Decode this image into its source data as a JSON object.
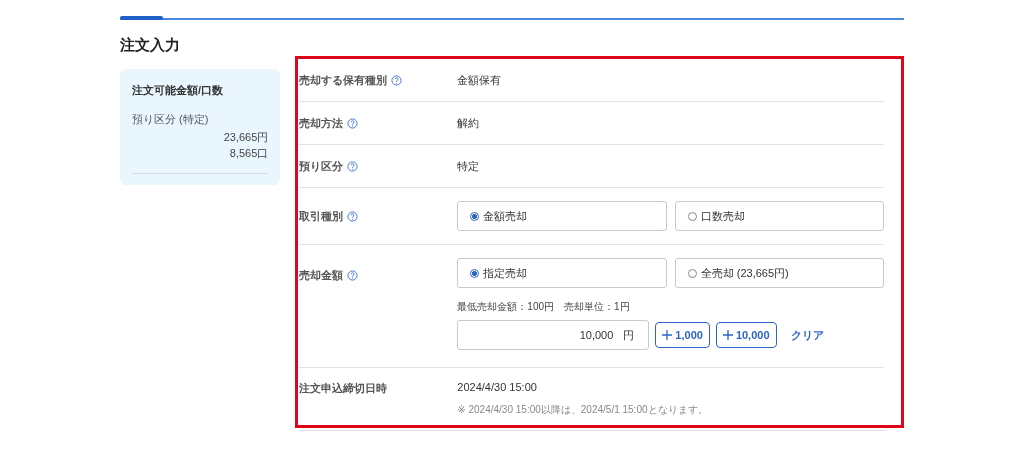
{
  "progress": {
    "level": 0.055
  },
  "title": "注文入力",
  "summary": {
    "heading": "注文可能金額/口数",
    "label": "預り区分 (特定)",
    "values": [
      "23,665円",
      "8,565口"
    ]
  },
  "rows": [
    {
      "kind": "text",
      "label": "売却する保有種別",
      "help": true,
      "value": "金額保有"
    },
    {
      "kind": "text",
      "label": "売却方法",
      "help": true,
      "value": "解約"
    },
    {
      "kind": "text",
      "label": "預り区分",
      "help": true,
      "value": "特定"
    },
    {
      "kind": "radio",
      "label": "取引種別",
      "help": true,
      "options": [
        {
          "label": "金額売却",
          "selected": true
        },
        {
          "label": "口数売却",
          "selected": false
        }
      ]
    },
    {
      "kind": "amount",
      "label": "売却金額",
      "help": true,
      "options": [
        {
          "label": "指定売却",
          "selected": true
        },
        {
          "label": "全売却 (23,665円)",
          "selected": false
        }
      ],
      "note": "最低売却金額：100円　売却単位：1円",
      "amount": "10,000",
      "unit": "円",
      "add_buttons": [
        "1,000",
        "10,000"
      ],
      "clear": "クリア"
    },
    {
      "kind": "deadline",
      "label": "注文申込締切日時",
      "help": false,
      "value": "2024/4/30 15:00",
      "note": "※ 2024/4/30 15:00以降は、2024/5/1 15:00となります。"
    }
  ]
}
